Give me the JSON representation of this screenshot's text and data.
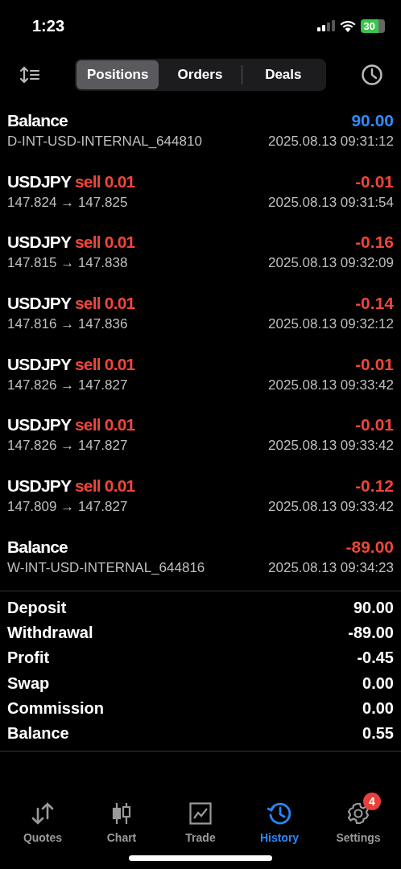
{
  "status_bar": {
    "time": "1:23",
    "battery": "30"
  },
  "tabs": [
    {
      "label": "Positions",
      "selected": true
    },
    {
      "label": "Orders",
      "selected": false
    },
    {
      "label": "Deals",
      "selected": false
    }
  ],
  "deals": [
    {
      "kind": "balance",
      "title": "Balance",
      "amount": "90.00",
      "color": "#2f8cff",
      "comment": "D-INT-USD-INTERNAL_644810",
      "time": "2025.08.13 09:31:12"
    },
    {
      "kind": "trade",
      "symbol": "USDJPY",
      "side": "sell 0.01",
      "amount": "-0.01",
      "color": "#f0453a",
      "prices": "147.824 → 147.825",
      "time": "2025.08.13 09:31:54"
    },
    {
      "kind": "trade",
      "symbol": "USDJPY",
      "side": "sell 0.01",
      "amount": "-0.16",
      "color": "#f0453a",
      "prices": "147.815 → 147.838",
      "time": "2025.08.13 09:32:09"
    },
    {
      "kind": "trade",
      "symbol": "USDJPY",
      "side": "sell 0.01",
      "amount": "-0.14",
      "color": "#f0453a",
      "prices": "147.816 → 147.836",
      "time": "2025.08.13 09:32:12"
    },
    {
      "kind": "trade",
      "symbol": "USDJPY",
      "side": "sell 0.01",
      "amount": "-0.01",
      "color": "#f0453a",
      "prices": "147.826 → 147.827",
      "time": "2025.08.13 09:33:42"
    },
    {
      "kind": "trade",
      "symbol": "USDJPY",
      "side": "sell 0.01",
      "amount": "-0.01",
      "color": "#f0453a",
      "prices": "147.826 → 147.827",
      "time": "2025.08.13 09:33:42"
    },
    {
      "kind": "trade",
      "symbol": "USDJPY",
      "side": "sell 0.01",
      "amount": "-0.12",
      "color": "#f0453a",
      "prices": "147.809 → 147.827",
      "time": "2025.08.13 09:33:42"
    },
    {
      "kind": "balance",
      "title": "Balance",
      "amount": "-89.00",
      "color": "#f0453a",
      "comment": "W-INT-USD-INTERNAL_644816",
      "time": "2025.08.13 09:34:23"
    }
  ],
  "summary": [
    {
      "label": "Deposit",
      "value": "90.00"
    },
    {
      "label": "Withdrawal",
      "value": "-89.00"
    },
    {
      "label": "Profit",
      "value": "-0.45"
    },
    {
      "label": "Swap",
      "value": "0.00"
    },
    {
      "label": "Commission",
      "value": "0.00"
    },
    {
      "label": "Balance",
      "value": "0.55"
    }
  ],
  "nav": [
    {
      "label": "Quotes",
      "kind": "quotes",
      "selected": false
    },
    {
      "label": "Chart",
      "kind": "chart",
      "selected": false
    },
    {
      "label": "Trade",
      "kind": "trade",
      "selected": false
    },
    {
      "label": "History",
      "kind": "history",
      "selected": true
    },
    {
      "label": "Settings",
      "kind": "settings",
      "selected": false,
      "badge": "4"
    }
  ]
}
